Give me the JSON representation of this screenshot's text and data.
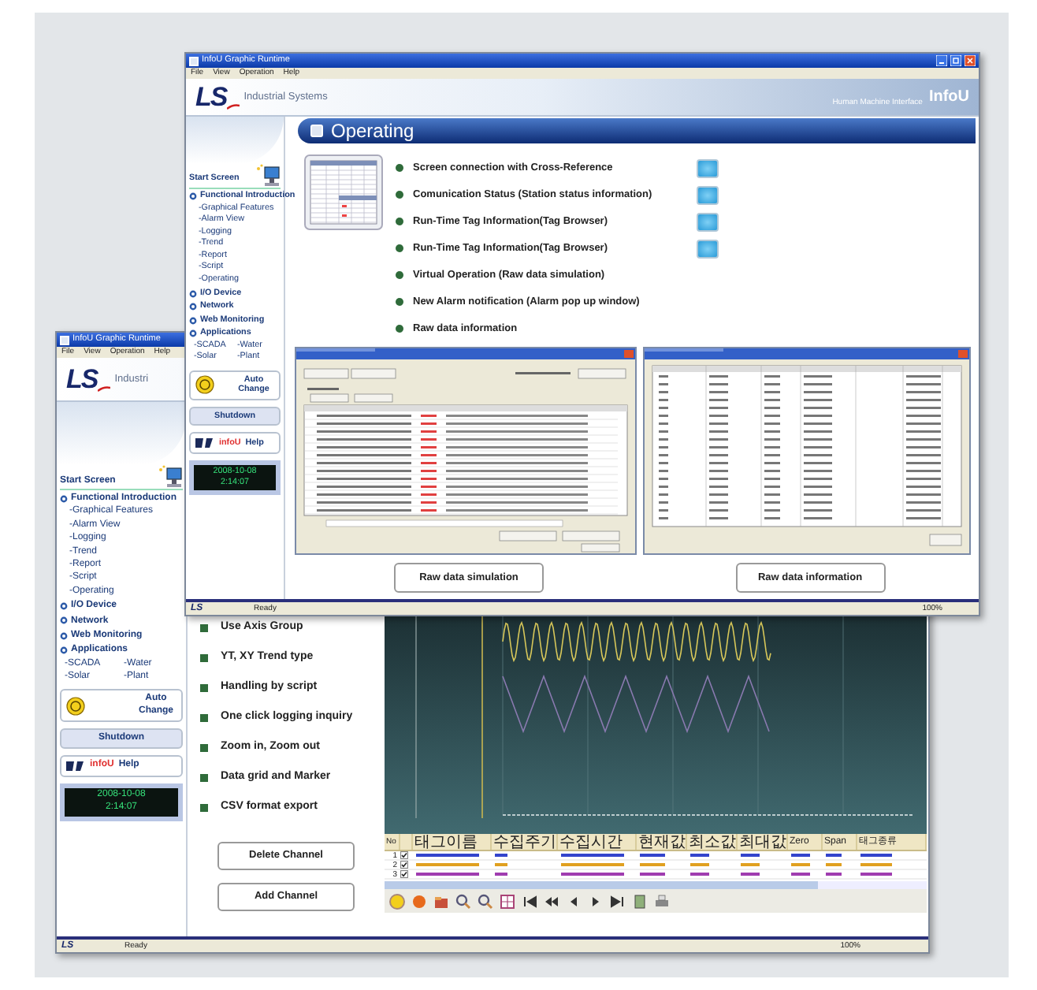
{
  "front_window": {
    "title": "InfoU Graphic Runtime",
    "menu": [
      "File",
      "View",
      "Operation",
      "Help"
    ],
    "logo": "LS",
    "brand": "Industrial Systems",
    "tagline": "Human Machine Interface",
    "product": "InfoU",
    "sidebar": {
      "start": "Start Screen",
      "sections": [
        {
          "label": "Functional Introduction",
          "kind": "list",
          "children": [
            "-Graphical Features",
            "-Alarm View",
            "-Logging",
            "-Trend",
            "-Report",
            "-Script",
            "-Operating"
          ]
        },
        {
          "label": "I/O Device"
        },
        {
          "label": "Network"
        },
        {
          "label": "Web Monitoring"
        },
        {
          "label": "Applications",
          "kind": "grid",
          "children": [
            "-SCADA",
            "-Water",
            "-Solar",
            "-Plant"
          ]
        }
      ],
      "auto_change": "Auto Change",
      "shutdown": "Shutdown",
      "help_brand": "infoU",
      "help": "Help",
      "clock": [
        "2008-10-08",
        "2:14:07"
      ]
    },
    "heading": "Operating",
    "features": [
      {
        "text": "Screen connection with Cross-Reference",
        "link_button": true
      },
      {
        "text": "Comunication Status (Station status information)",
        "link_button": true
      },
      {
        "text": "Run-Time Tag Information(Tag Browser)",
        "link_button": true
      },
      {
        "text": "Run-Time Tag Information(Tag Browser)",
        "link_button": true
      },
      {
        "text": "Virtual Operation (Raw data simulation)",
        "link_button": false
      },
      {
        "text": "New Alarm notification (Alarm pop up window)",
        "link_button": false
      },
      {
        "text": "Raw data information",
        "link_button": false
      }
    ],
    "dialog_buttons": [
      "Raw data simulation",
      "Raw data information"
    ],
    "status_bar": {
      "logo": "LS",
      "text": "Ready",
      "zoom": "100%"
    }
  },
  "back_window": {
    "title": "InfoU Graphic Runtime",
    "menu": [
      "File",
      "View",
      "Operation",
      "Help"
    ],
    "logo": "LS",
    "brand": "Industri",
    "sidebar": {
      "start": "Start Screen",
      "sections": [
        {
          "label": "Functional Introduction",
          "kind": "list",
          "children": [
            "-Graphical Features",
            "-Alarm View",
            "-Logging",
            "-Trend",
            "-Report",
            "-Script",
            "-Operating"
          ]
        },
        {
          "label": "I/O Device"
        },
        {
          "label": "Network"
        },
        {
          "label": "Web Monitoring"
        },
        {
          "label": "Applications",
          "kind": "grid",
          "children": [
            "-SCADA",
            "-Water",
            "-Solar",
            "-Plant"
          ]
        }
      ],
      "auto_change": "Auto Change",
      "shutdown": "Shutdown",
      "help_brand": "infoU",
      "help": "Help",
      "clock": [
        "2008-10-08",
        "2:14:07"
      ]
    },
    "features": [
      "Use Axis Group",
      "YT, XY Trend type",
      "Handling by script",
      "One click logging inquiry",
      "Zoom in, Zoom out",
      "Data grid and Marker",
      "CSV format export"
    ],
    "grid": {
      "columns": [
        "No",
        "",
        "태그이름",
        "수집주기",
        "수집시간",
        "현재값",
        "최소값",
        "최대값",
        "Zero",
        "Span",
        "태그종류"
      ],
      "rows": [
        {
          "no": "1",
          "checked": true,
          "color": "#3344cc"
        },
        {
          "no": "2",
          "checked": true,
          "color": "#e0a020"
        },
        {
          "no": "3",
          "checked": true,
          "color": "#a03cb0"
        }
      ]
    },
    "buttons": [
      "Delete Channel",
      "Add Channel"
    ],
    "status_bar": {
      "logo": "LS",
      "text": "Ready",
      "zoom": "100%"
    }
  }
}
